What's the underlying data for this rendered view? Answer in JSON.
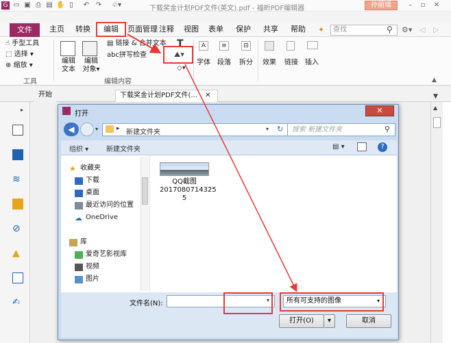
{
  "titlebar": {
    "title": "下载奖金计划PDF文件(英文).pdf - 福昕PDF编辑器",
    "user": "孙丽瑶"
  },
  "menu": {
    "file": "文件",
    "home": "主页",
    "convert": "转换",
    "edit": "编辑",
    "organize": "页面管理",
    "comment": "注释",
    "view": "视图",
    "form": "表单",
    "protect": "保护",
    "share": "共享",
    "help": "帮助",
    "search_placeholder": "查找"
  },
  "ribbon": {
    "hand": "手型工具",
    "select": "选择",
    "zoom": "缩放",
    "tools_group": "工具",
    "edit_text_l1": "编辑",
    "edit_text_l2": "文本",
    "edit_obj_l1": "编辑",
    "edit_obj_l2": "对象",
    "link_merge": "链接 & 合并文本",
    "spell": "拼写检查",
    "edit_group": "编辑内容",
    "font": "字体",
    "para": "段落",
    "split": "拆分",
    "effect": "效果",
    "link": "链接",
    "insert": "插入"
  },
  "tabs": {
    "start": "开始",
    "doc": "下载奖金计划PDF文件(..."
  },
  "dialog": {
    "title": "打开",
    "path": "新建文件夹",
    "search_placeholder": "搜索 新建文件夹",
    "organize": "组织 ▾",
    "new_folder": "新建文件夹",
    "favorites": "收藏夹",
    "downloads": "下载",
    "desktop": "桌面",
    "recent": "最近访问的位置",
    "onedrive": "OneDrive",
    "library": "库",
    "iqiyi": "爱奇艺影视库",
    "videos": "视频",
    "pictures": "图片",
    "file_name_label": "文件名(N):",
    "file_name_value": "",
    "file_type": "所有可支持的图像",
    "open": "打开(O)",
    "cancel": "取消",
    "file_item": {
      "name_l1": "QQ截图",
      "name_l2": "2017080714325",
      "name_l3": "5"
    }
  }
}
